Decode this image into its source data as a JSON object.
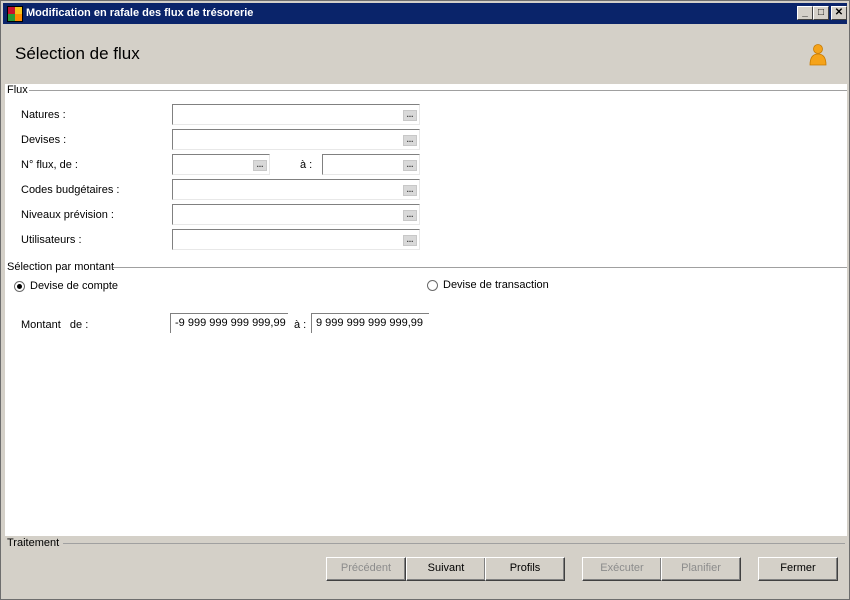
{
  "window": {
    "title": "Modification en rafale des flux de trésorerie",
    "minimize": "_",
    "maximize": "□",
    "close": "✕"
  },
  "header": {
    "title": "Sélection de flux"
  },
  "flux_group": {
    "label": "Flux",
    "fields": [
      {
        "label": "Natures :",
        "value": ""
      },
      {
        "label": "Devises :",
        "value": ""
      },
      {
        "label": "N° flux, de :",
        "value": ""
      },
      {
        "label": "Codes budgétaires :",
        "value": ""
      },
      {
        "label": "Niveaux prévision :",
        "value": ""
      },
      {
        "label": "Utilisateurs :",
        "value": ""
      }
    ],
    "flux_to_label": "à :",
    "flux_to_value": "",
    "ellipsis": "..."
  },
  "amount_group": {
    "label": "Sélection par montant",
    "radio_account": "Devise de compte",
    "radio_transaction": "Devise de transaction",
    "selected": "account",
    "amount_label": "Montant   de :",
    "amount_from": "-9 999 999 999 999,99",
    "to_label": "à :",
    "amount_to": "9 999 999 999 999,99"
  },
  "footer": {
    "label": "Traitement",
    "buttons": {
      "previous": "Précédent",
      "next": "Suivant",
      "profiles": "Profils",
      "execute": "Exécuter",
      "schedule": "Planifier",
      "close": "Fermer"
    }
  },
  "colors": {
    "titlebar": "#0a246a",
    "chrome": "#d4d0c8",
    "user_icon": "#f5a31a"
  }
}
